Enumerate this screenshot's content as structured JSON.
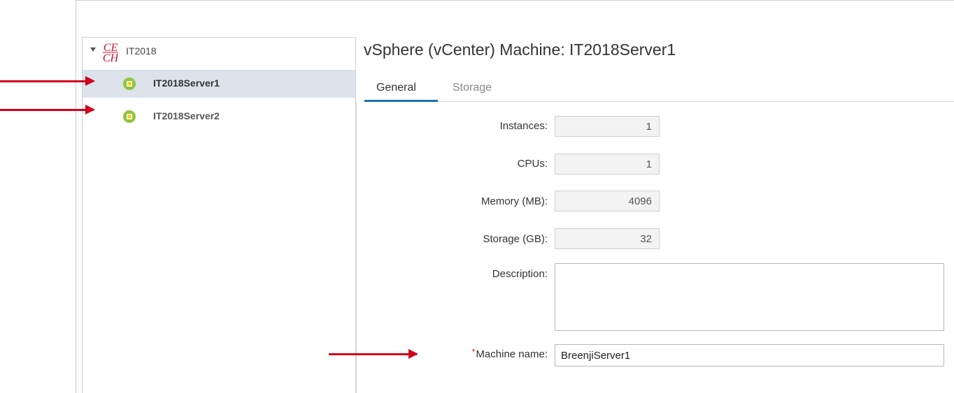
{
  "tree": {
    "root_label": "IT2018",
    "items": [
      {
        "label": "IT2018Server1",
        "selected": true
      },
      {
        "label": "IT2018Server2",
        "selected": false
      }
    ]
  },
  "panel": {
    "title": "vSphere (vCenter) Machine: IT2018Server1",
    "tabs": [
      {
        "label": "General",
        "active": true
      },
      {
        "label": "Storage",
        "active": false
      }
    ]
  },
  "form": {
    "instances_label": "Instances:",
    "instances_value": "1",
    "cpus_label": "CPUs:",
    "cpus_value": "1",
    "memory_label": "Memory (MB):",
    "memory_value": "4096",
    "storage_label": "Storage (GB):",
    "storage_value": "32",
    "description_label": "Description:",
    "description_value": "",
    "machine_name_required": "*",
    "machine_name_label": "Machine name:",
    "machine_name_value": "BreenjiServer1"
  },
  "colors": {
    "accent": "#1a73b5",
    "annotation_arrow": "#d0021b",
    "vm_icon_green": "#8cc63f",
    "vm_icon_yellow": "#f5d300",
    "selected_row": "#dde3ea",
    "logo_red": "#c8102e"
  },
  "icons": {
    "root": "cech-logo-icon",
    "vm": "vm-powered-on-icon",
    "expand": "caret-down-icon"
  }
}
